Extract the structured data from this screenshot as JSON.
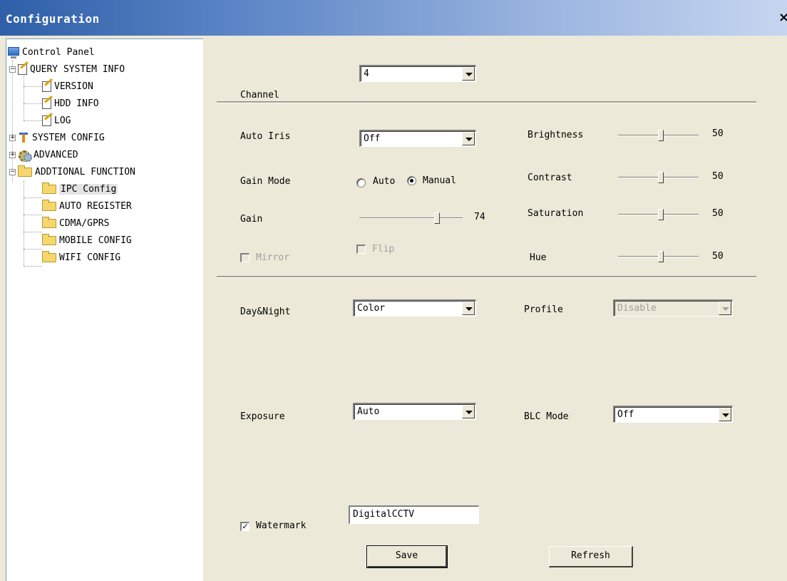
{
  "window": {
    "title": "Configuration",
    "close_glyph": "×"
  },
  "tree": {
    "root": "Control Panel",
    "query": "QUERY SYSTEM INFO",
    "version": "VERSION",
    "hdd": "HDD INFO",
    "log": "LOG",
    "system_config": "SYSTEM CONFIG",
    "advanced": "ADVANCED",
    "additional": "ADDTIONAL FUNCTION",
    "ipc": "IPC Config",
    "auto_register": "AUTO REGISTER",
    "cdma": "CDMA/GPRS",
    "mobile": "MOBILE CONFIG",
    "wifi": "WIFI CONFIG",
    "expanded_glyph": "−",
    "collapsed_glyph": "+"
  },
  "form": {
    "channel_label": "Channel",
    "channel_value": "4",
    "auto_iris_label": "Auto Iris",
    "auto_iris_value": "Off",
    "gain_mode_label": "Gain Mode",
    "gain_mode_auto": "Auto",
    "gain_mode_manual": "Manual",
    "gain_mode_selected": "Manual",
    "gain_label": "Gain",
    "gain_value": "74",
    "mirror_label": "Mirror",
    "flip_label": "Flip",
    "brightness_label": "Brightness",
    "brightness_value": "50",
    "contrast_label": "Contrast",
    "contrast_value": "50",
    "saturation_label": "Saturation",
    "saturation_value": "50",
    "hue_label": "Hue",
    "hue_value": "50",
    "daynight_label": "Day&Night",
    "daynight_value": "Color",
    "profile_label": "Profile",
    "profile_value": "Disable",
    "exposure_label": "Exposure",
    "exposure_value": "Auto",
    "blc_label": "BLC Mode",
    "blc_value": "Off",
    "watermark_label": "Watermark",
    "watermark_checked": true,
    "watermark_check_glyph": "✓",
    "watermark_text": "DigitalCCTV",
    "save_label": "Save",
    "refresh_label": "Refresh"
  },
  "colors": {
    "title_bar_start": "#2e5fa8",
    "title_bar_end": "#c6d6f0",
    "dialog_bg": "#ece9d8",
    "tree_bg": "#ffffff"
  }
}
